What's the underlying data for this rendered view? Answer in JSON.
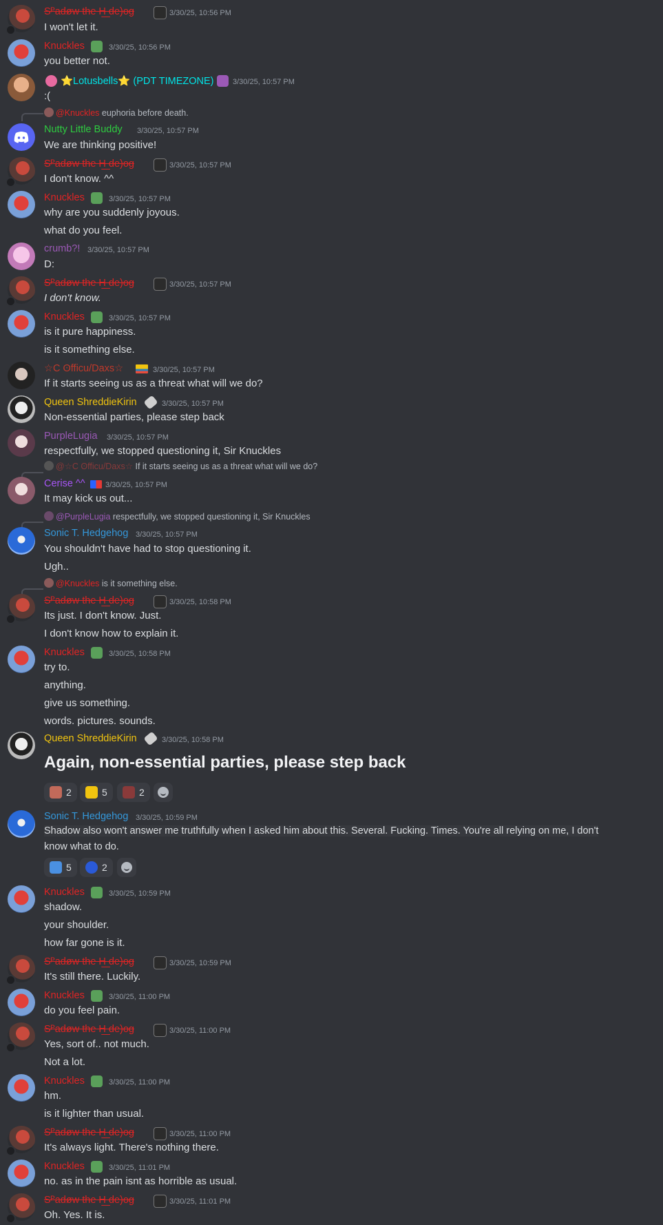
{
  "colors": {
    "background": "#313338",
    "text": "#dbdee1",
    "muted": "#949ba4",
    "shadow": "#e02424",
    "knuckles": "#e02424",
    "lotus": "#00e5e8",
    "nutty": "#2ecc40",
    "crumb": "#9b59b6",
    "daxs": "#c0392b",
    "queen": "#f1c40f",
    "purplelugia": "#9b59b6",
    "cerise": "#a855f7",
    "sonic": "#3498db"
  },
  "users": {
    "shadow": "Sᴾadøw the H͟ de)og",
    "knuckles": "Knuckles",
    "lotus": "⭐Lotusbells⭐ (PDT TIMEZONE)",
    "nutty": "Nutty Little Buddy",
    "crumb": "crumb?!",
    "daxs": "☆C ʘfficu/Daxs☆",
    "queen": "Queen ShreddieKirin",
    "purplelugia": "PurpleLugia",
    "cerise": "Cerise ^^",
    "sonic": "Sonic T. Hedgehog"
  },
  "messages": [
    {
      "ts": "3/30/25, 10:56 PM",
      "lines": [
        "I won't let it."
      ]
    },
    {
      "ts": "3/30/25, 10:56 PM",
      "lines": [
        "you better not."
      ]
    },
    {
      "ts": "3/30/25, 10:57 PM",
      "lines": [
        ":("
      ]
    },
    {
      "reply_user": "@Knuckles",
      "reply_text": "euphoria before death.",
      "ts": "3/30/25, 10:57 PM",
      "lines": [
        "We are thinking positive!"
      ]
    },
    {
      "ts": "3/30/25, 10:57 PM",
      "lines": [
        "I don't know. ^^"
      ]
    },
    {
      "ts": "3/30/25, 10:57 PM",
      "lines": [
        "why are you suddenly joyous.",
        "what do you feel."
      ]
    },
    {
      "ts": "3/30/25, 10:57 PM",
      "lines": [
        "D:"
      ]
    },
    {
      "ts": "3/30/25, 10:57 PM",
      "lines": [
        "I don't know."
      ]
    },
    {
      "ts": "3/30/25, 10:57 PM",
      "lines": [
        "is it pure happiness.",
        "is it something else."
      ]
    },
    {
      "ts": "3/30/25, 10:57 PM",
      "lines": [
        "If it starts seeing us as a threat what will we do?"
      ]
    },
    {
      "ts": "3/30/25, 10:57 PM",
      "lines": [
        "Non-essential parties, please step back"
      ]
    },
    {
      "ts": "3/30/25, 10:57 PM",
      "lines": [
        "respectfully, we stopped questioning it, Sir Knuckles"
      ]
    },
    {
      "reply_user": "@☆C ʘfficu/Daxs☆",
      "reply_text": "If it starts seeing us as a threat what will we do?",
      "ts": "3/30/25, 10:57 PM",
      "lines": [
        "It may kick us out..."
      ]
    },
    {
      "reply_user": "@PurpleLugia",
      "reply_text": "respectfully, we stopped questioning it, Sir Knuckles",
      "ts": "3/30/25, 10:57 PM",
      "lines": [
        "You shouldn't have had to stop questioning it.",
        "Ugh.."
      ]
    },
    {
      "reply_user": "@Knuckles",
      "reply_text": "is it something else.",
      "ts": "3/30/25, 10:58 PM",
      "lines": [
        "Its just. I don't know. Just.",
        "I don't know how to explain it."
      ]
    },
    {
      "ts": "3/30/25, 10:58 PM",
      "lines": [
        "try to.",
        "anything.",
        "give us something.",
        "words. pictures. sounds."
      ]
    },
    {
      "ts": "3/30/25, 10:58 PM",
      "lines": [
        "Again, non-essential parties, please step back"
      ],
      "reactions": [
        "2",
        "5",
        "2"
      ]
    },
    {
      "ts": "3/30/25, 10:59 PM",
      "lines": [
        "Shadow also won't answer me truthfully when I asked him about this. Several. Fucking. Times. You're all relying on me, I don't",
        "know what to do."
      ],
      "reactions": [
        "5",
        "2"
      ]
    },
    {
      "ts": "3/30/25, 10:59 PM",
      "lines": [
        "shadow.",
        "your shoulder.",
        "how far gone is it."
      ]
    },
    {
      "ts": "3/30/25, 10:59 PM",
      "lines": [
        "It's still there. Luckily."
      ]
    },
    {
      "ts": "3/30/25, 11:00 PM",
      "lines": [
        "do you feel pain."
      ]
    },
    {
      "ts": "3/30/25, 11:00 PM",
      "lines": [
        "Yes, sort of.. not much.",
        "Not a lot."
      ]
    },
    {
      "ts": "3/30/25, 11:00 PM",
      "lines": [
        "hm.",
        "is it lighter than usual."
      ]
    },
    {
      "ts": "3/30/25, 11:00 PM",
      "lines": [
        "It's always light. There's nothing there."
      ]
    },
    {
      "ts": "3/30/25, 11:01 PM",
      "lines": [
        "no. as in the pain isnt as horrible as usual."
      ]
    },
    {
      "ts": "3/30/25, 11:01 PM",
      "lines": [
        "Oh. Yes. It is."
      ]
    }
  ]
}
